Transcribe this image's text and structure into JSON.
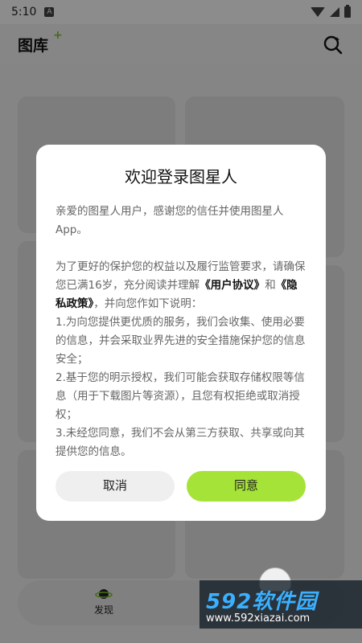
{
  "status_bar": {
    "time": "5:10",
    "a_label": "A"
  },
  "header": {
    "title": "图库",
    "plus": "+"
  },
  "bottom_nav": {
    "discover_label": "发现"
  },
  "dialog": {
    "title": "欢迎登录图星人",
    "intro": "亲爱的图星人用户，感谢您的信任并使用图星人 App。",
    "p2_before": "为了更好的保护您的权益以及履行监管要求，请确保您已满16岁，充分阅读并理解",
    "user_agreement": "《用户协议》",
    "and": "和",
    "privacy_policy": "《隐私政策》",
    "p2_after": "，并向您作如下说明：",
    "item1": "1.为向您提供更优质的服务，我们会收集、使用必要的信息，并会采取业界先进的安全措施保护您的信息安全；",
    "item2": "2.基于您的明示授权，我们可能会获取存储权限等信息（用于下载图片等资源），且您有权拒绝或取消授权；",
    "item3": "3.未经您同意，我们不会从第三方获取、共享或向其提供您的信息。",
    "cancel_label": "取消",
    "agree_label": "同意"
  },
  "watermark": {
    "main": "592软件园",
    "url": "www.592xiazai.com"
  },
  "colors": {
    "accent_green": "#a6e338",
    "plus_green": "#7ec42a",
    "watermark_blue": "#3ab0ff"
  }
}
